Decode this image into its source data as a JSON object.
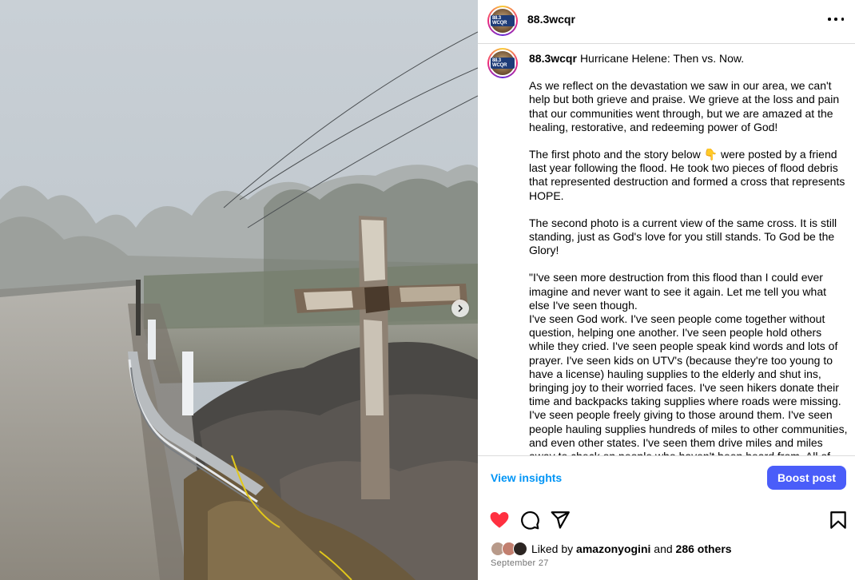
{
  "post": {
    "username": "88.3wcqr",
    "avatar_text": "88.3 WCQR",
    "caption_title": "Hurricane Helene: Then vs. Now.",
    "paragraphs": [
      "As we reflect on the devastation we saw in our area, we can't help but both grieve and praise. We grieve at the loss and pain that our communities went through, but we are amazed at the healing, restorative, and redeeming power of God!",
      "The first photo and the story below 👇 were posted by a friend last year following the flood. He took two pieces of flood debris that represented destruction and formed a cross that represents HOPE.",
      "The second photo is a current view of the same cross. It is still standing, just as God's love for you still stands. To God be the Glory!",
      "\"I've seen more destruction from this flood than I could ever imagine and never want to see it again. Let me tell you what else I've seen though.\nI've seen God work. I've seen people come together without question, helping one another. I've seen people hold others while they cried. I've seen people speak kind words and lots of prayer. I've seen kids on UTV's (because they're too young to have a license) hauling supplies to the elderly and shut ins, bringing joy to their worried faces. I've seen hikers donate their time and backpacks taking supplies where roads were missing. I've seen people freely giving to those around them. I've seen people hauling supplies hundreds of miles to other communities, and even other states. I've seen them drive miles and miles away to check on people who haven't been heard from. All of these"
    ],
    "view_insights": "View insights",
    "boost_post": "Boost post",
    "liked_by_prefix": "Liked by",
    "liked_by_user": "amazonyogini",
    "liked_by_and": "and",
    "liked_by_others": "286 others",
    "date": "September 27"
  },
  "icons": {
    "more": "more-horizontal-icon",
    "next": "chevron-right-icon",
    "like": "heart-filled-icon",
    "comment": "comment-icon",
    "share": "send-icon",
    "save": "bookmark-icon"
  },
  "colors": {
    "like_red": "#ff3040",
    "link_blue": "#0095f6",
    "boost_blue": "#4a5df9",
    "muted": "#737373"
  }
}
